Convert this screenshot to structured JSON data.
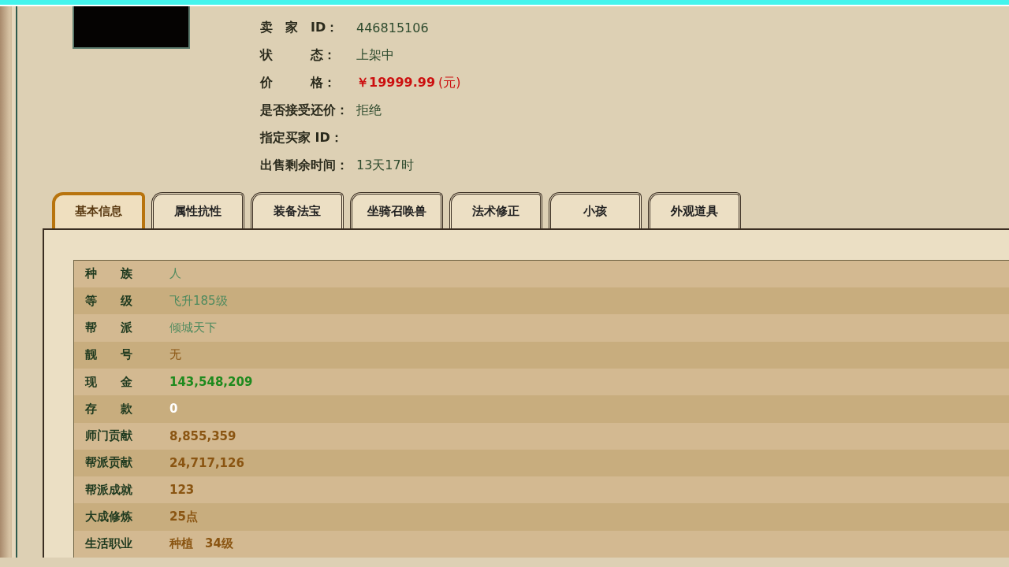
{
  "seller_info": [
    {
      "label": "卖　家　ID：",
      "value": "446815106",
      "kind": "plain"
    },
    {
      "label": "状　　　态：",
      "value": "上架中",
      "kind": "plain"
    },
    {
      "label": "价　　　格：",
      "value": "￥19999.99",
      "unit": "(元)",
      "kind": "price"
    },
    {
      "label": "是否接受还价：",
      "value": "拒绝",
      "kind": "plain"
    },
    {
      "label": "指定买家 ID：",
      "kind": "plain"
    },
    {
      "label": "出售剩余时间：",
      "value": "13天17时",
      "kind": "plain"
    }
  ],
  "tabs": [
    {
      "label": "基本信息",
      "selected": true
    },
    {
      "label": "属性抗性",
      "selected": false
    },
    {
      "label": "装备法宝",
      "selected": false
    },
    {
      "label": "坐骑召唤兽",
      "selected": false
    },
    {
      "label": "法术修正",
      "selected": false
    },
    {
      "label": "小孩",
      "selected": false
    },
    {
      "label": "外观道具",
      "selected": false
    }
  ],
  "table": {
    "rows": [
      {
        "label": "种　　族",
        "value": "人",
        "color": "#4e8a5e",
        "bold": false
      },
      {
        "label": "等　　级",
        "value": "飞升185级",
        "color": "#4e8a5e",
        "bold": false
      },
      {
        "label": "帮　　派",
        "value": "倾城天下",
        "color": "#4e8a5e",
        "bold": false
      },
      {
        "label": "靓　　号",
        "value": "无",
        "color": "#8a5512",
        "bold": false
      },
      {
        "label": "现　　金",
        "value": "143,548,209",
        "color": "#1e8a1e",
        "bold": true
      },
      {
        "label": "存　　款",
        "value": "0",
        "color": "#ffffff",
        "bold": true
      },
      {
        "label": "师门贡献",
        "value": "8,855,359",
        "color": "#8a5512",
        "bold": true
      },
      {
        "label": "帮派贡献",
        "value": "24,717,126",
        "color": "#8a5512",
        "bold": true
      },
      {
        "label": "帮派成就",
        "value": "123",
        "color": "#8a5512",
        "bold": true
      },
      {
        "label": "大成修炼",
        "value": "25点",
        "color": "#8a5512",
        "bold": true
      },
      {
        "label": "生活职业",
        "value": "种植　34级",
        "color": "#8a5512",
        "bold": true
      }
    ]
  }
}
